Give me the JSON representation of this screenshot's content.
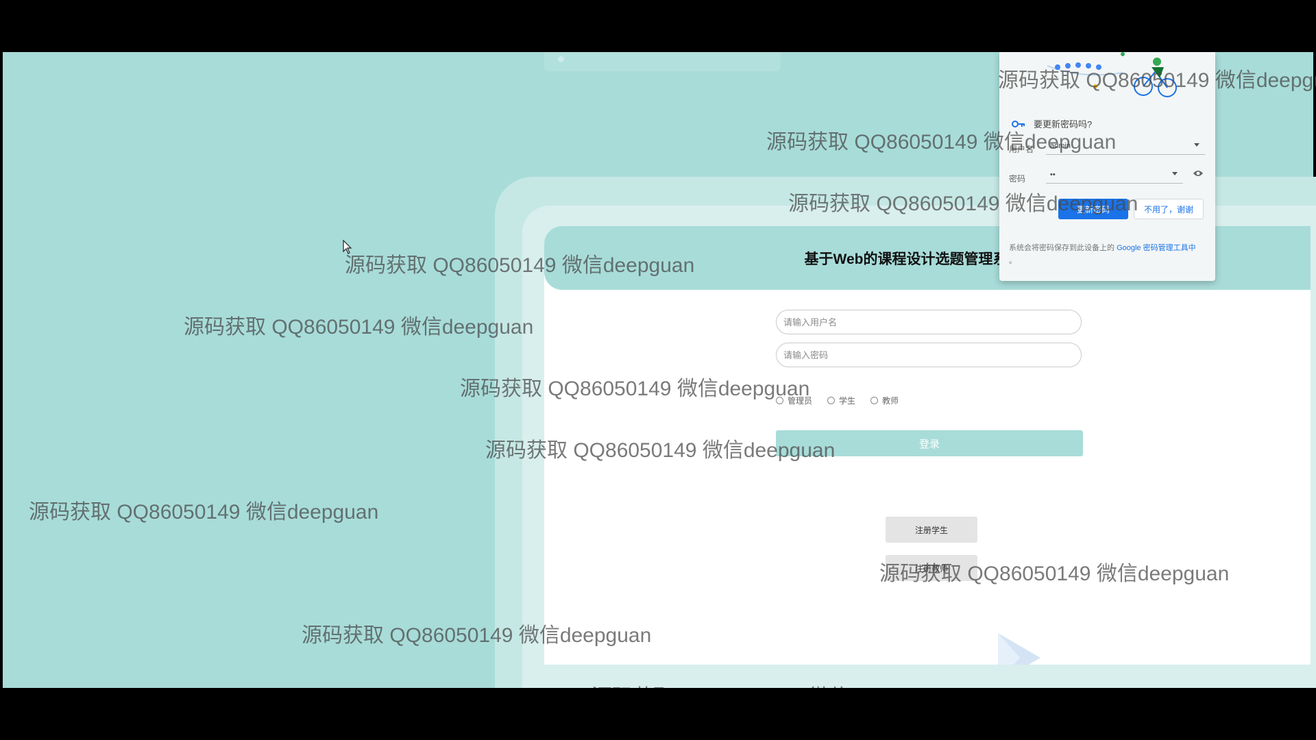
{
  "page_title": "基于Web的课程设计选题管理系统登录",
  "login_form": {
    "username_placeholder": "请输入用户名",
    "password_placeholder": "请输入密码",
    "roles": [
      "管理员",
      "学生",
      "教师"
    ],
    "login_label": "登录",
    "register_student_label": "注册学生",
    "register_teacher_label": "注册教师"
  },
  "password_popup": {
    "heading": "要更新密码吗?",
    "username_label": "用户名",
    "username_value": "admin",
    "password_label": "密码",
    "password_value": "••",
    "update_label": "更新密码",
    "dismiss_label": "不用了，谢谢",
    "footer_text": "系统会将密码保存到此设备上的",
    "footer_link": "Google 密码管理工具中",
    "footer_end": "。"
  },
  "watermark": {
    "text": "源码获取 QQ86050149 微信deepguan",
    "text_partial": "源码获取 QQ86050149 微信d"
  },
  "colors": {
    "theme_teal": "#a8dcd9",
    "google_blue": "#1a73e8"
  },
  "icons": [
    "key-icon",
    "eye-icon",
    "mouse-cursor-icon"
  ]
}
